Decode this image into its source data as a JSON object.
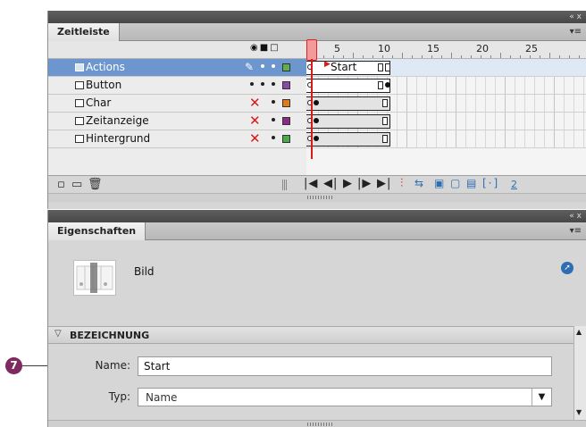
{
  "callout": {
    "number": "7"
  },
  "timeline": {
    "title_controls": "«  x",
    "tab": "Zeitleiste",
    "ruler_labels": [
      "5",
      "10",
      "15",
      "20",
      "25"
    ],
    "layers": [
      {
        "name": "Actions",
        "color": "#5fb04a",
        "frame_label": "Start",
        "selected": true
      },
      {
        "name": "Button",
        "color": "#8b4aa8"
      },
      {
        "name": "Char",
        "color": "#e07b18"
      },
      {
        "name": "Zeitanzeige",
        "color": "#8b2a8b"
      },
      {
        "name": "Hintergrund",
        "color": "#4aaa4a"
      }
    ],
    "footer_frame": "2"
  },
  "properties": {
    "title_controls": "«  x",
    "tab": "Eigenschaften",
    "symbol_type": "Bild",
    "section": "BEZEICHNUNG",
    "name_label": "Name:",
    "name_value": "Start",
    "type_label": "Typ:",
    "type_value": "Name"
  },
  "colors": {
    "titlebar": "#4a4a4a",
    "selection": "#6d96cf",
    "playhead": "#d81a1a",
    "callout": "#7d2a5e"
  }
}
